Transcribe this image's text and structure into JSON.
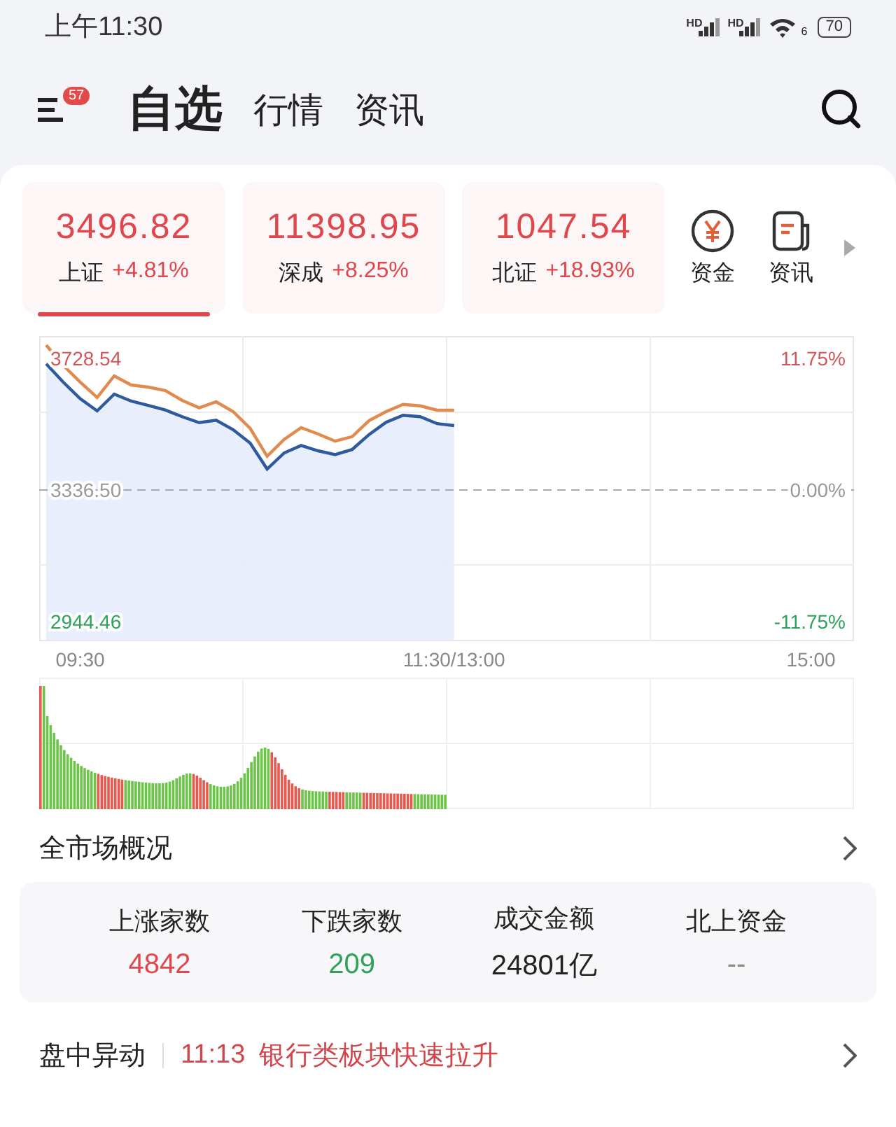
{
  "status_bar": {
    "time": "上午11:30",
    "signals": [
      "HD",
      "HD"
    ],
    "wifi_label": "6",
    "battery": "70"
  },
  "header": {
    "badge": "57",
    "tabs": [
      {
        "label": "自选",
        "selected": true
      },
      {
        "label": "行情",
        "selected": false
      },
      {
        "label": "资讯",
        "selected": false
      }
    ]
  },
  "indices": [
    {
      "value": "3496.82",
      "name": "上证",
      "change": "+4.81%",
      "kind": "up",
      "selected": true
    },
    {
      "value": "11398.95",
      "name": "深成",
      "change": "+8.25%",
      "kind": "up",
      "selected": false
    },
    {
      "value": "1047.54",
      "name": "北证",
      "change": "+18.93%",
      "kind": "up",
      "selected": false
    }
  ],
  "shortcuts": [
    {
      "label": "资金",
      "kind": "fund"
    },
    {
      "label": "资讯",
      "kind": "news"
    }
  ],
  "chart": {
    "chart_data": {
      "type": "line",
      "categories": [
        null,
        null,
        "09:30",
        null,
        null,
        null,
        null,
        null,
        null,
        null,
        null,
        null,
        null,
        null,
        null,
        null,
        null,
        null,
        null,
        null,
        null,
        null,
        null,
        null,
        "11:30/13:00",
        null,
        null,
        null,
        null,
        null,
        null,
        null,
        null,
        null,
        null,
        null,
        null,
        null,
        null,
        null,
        null,
        null,
        null,
        null,
        null,
        "15:00"
      ],
      "series": [
        {
          "color": "#e08a4f",
          "values": [
            3768,
            3708,
            3658,
            3612,
            3676,
            3649,
            3643,
            3633,
            3603,
            3581,
            3599,
            3570,
            3520,
            3437,
            3487,
            3522,
            3503,
            3482,
            3495,
            3543,
            3570,
            3591,
            3587,
            3574,
            3574,
            null,
            null,
            null,
            null,
            null,
            null,
            null,
            null,
            null,
            null,
            null,
            null,
            null,
            null,
            null,
            null,
            null,
            null,
            null,
            null,
            null
          ]
        },
        {
          "color": "#2f5a9e",
          "values": [
            3712,
            3658,
            3608,
            3572,
            3622,
            3601,
            3588,
            3575,
            3555,
            3537,
            3544,
            3516,
            3476,
            3399,
            3447,
            3469,
            3453,
            3442,
            3457,
            3502,
            3538,
            3559,
            3555,
            3534,
            3528,
            null,
            null,
            null,
            null,
            null,
            null,
            null,
            null,
            null,
            null,
            null,
            null,
            null,
            null,
            null,
            null,
            null,
            null,
            null,
            null,
            null
          ]
        }
      ],
      "ylim": [
        2886,
        3795
      ],
      "grid": true,
      "ref_lines": [
        {
          "axis": "y",
          "value": 3336.5
        }
      ],
      "yticks": [
        {
          "value": 3728.54,
          "label": "3728.54"
        },
        {
          "value": 3336.5,
          "label": "3336.50"
        },
        {
          "value": 2944.46,
          "label": "2944.46"
        }
      ]
    },
    "percent_labels": [
      "11.75%",
      "0.00%",
      "-11.75%"
    ]
  },
  "overview": {
    "title": "全市场概况",
    "stats": [
      {
        "label": "上涨家数",
        "value": "4842",
        "kind": "up"
      },
      {
        "label": "下跌家数",
        "value": "209",
        "kind": "down"
      },
      {
        "label": "成交金额",
        "value": "24801亿",
        "kind": "flat"
      },
      {
        "label": "北上资金",
        "value": "--",
        "kind": "none"
      }
    ]
  },
  "alert": {
    "title": "盘中异动",
    "time": "11:13",
    "text": "银行类板块快速拉升"
  }
}
